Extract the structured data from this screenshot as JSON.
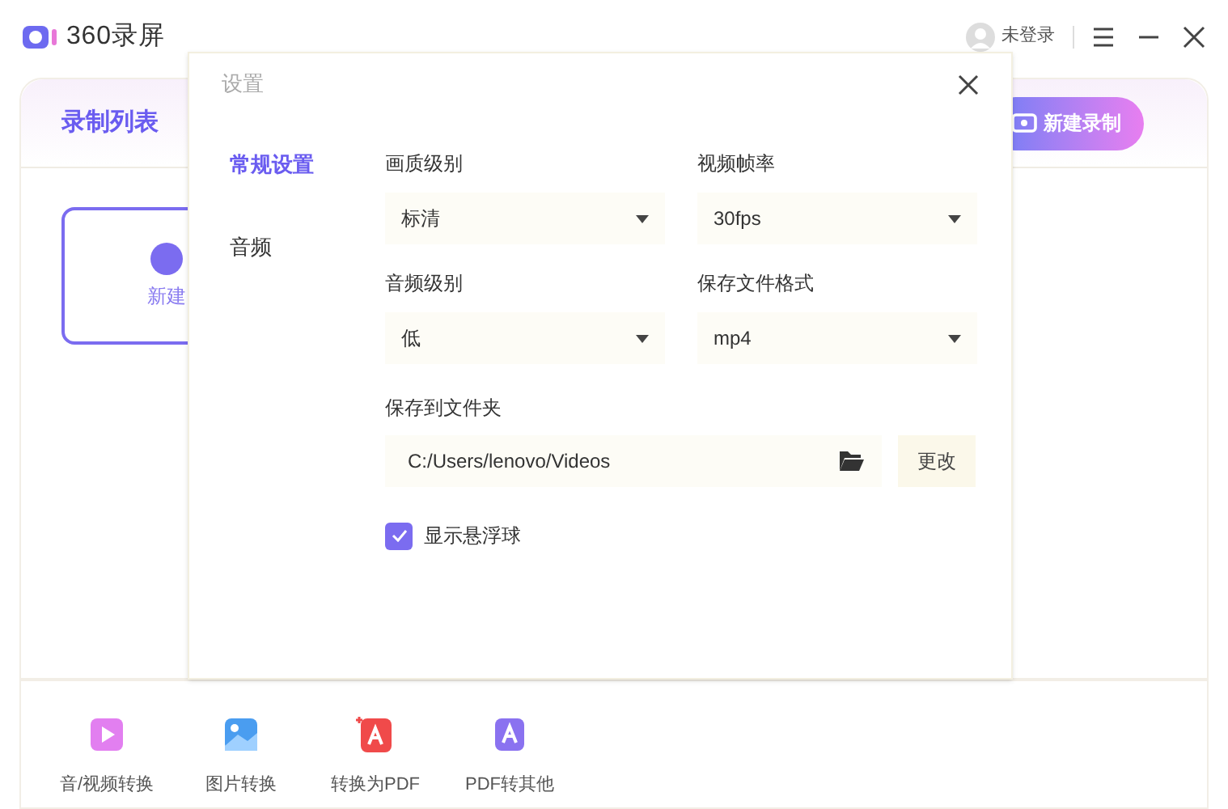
{
  "app": {
    "logo_text": "360录屏",
    "user": "未登录"
  },
  "main": {
    "tab": "录制列表",
    "new_button": "新建录制",
    "new_card": "新建"
  },
  "tools": [
    {
      "label": "音/视频转换",
      "kind": "video"
    },
    {
      "label": "图片转换",
      "kind": "image"
    },
    {
      "label": "转换为PDF",
      "kind": "topdf"
    },
    {
      "label": "PDF转其他",
      "kind": "frompdf"
    }
  ],
  "dialog": {
    "title": "设置",
    "nav": [
      {
        "label": "常规设置",
        "selected": true
      },
      {
        "label": "音频",
        "selected": false
      }
    ],
    "selects": [
      {
        "label": "画质级别",
        "value": "标清"
      },
      {
        "label": "视频帧率",
        "value": "30fps"
      },
      {
        "label": "音频级别",
        "value": "低"
      },
      {
        "label": "保存文件格式",
        "value": "mp4"
      }
    ],
    "folder": {
      "label": "保存到文件夹",
      "value": "C:/Users/lenovo/Videos",
      "button": "更改"
    },
    "checkbox": {
      "label": "显示悬浮球",
      "checked": true
    }
  }
}
